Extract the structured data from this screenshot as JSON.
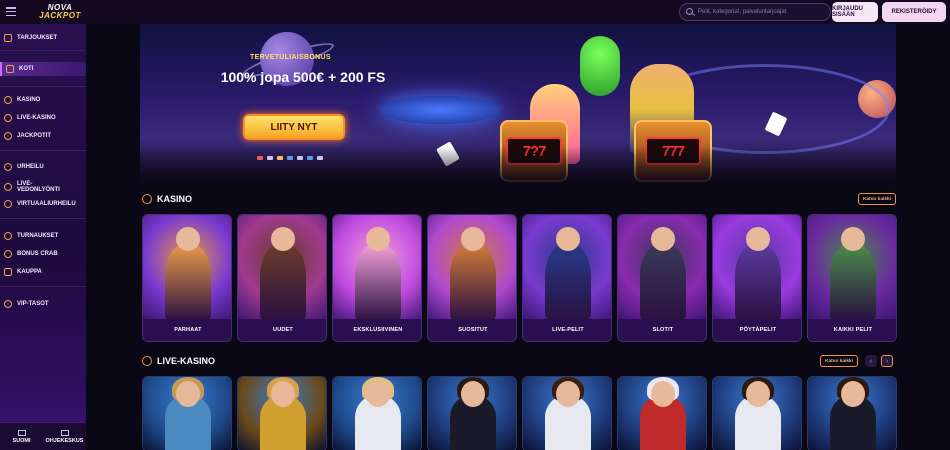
{
  "header": {
    "logo_line1": "NOVA",
    "logo_line2": "JACKPOT",
    "search_placeholder": "Pelit, kategoriat, palveluntarjoajat",
    "login_label": "KIRJAUDU SISÄÄN",
    "register_label": "REKISTERÖIDY"
  },
  "sidebar": {
    "items": [
      {
        "label": "TARJOUKSET",
        "icon": "gift-icon"
      },
      {
        "label": "KOTI",
        "icon": "home-icon",
        "active": true
      },
      {
        "label": "KASINO",
        "icon": "casino-chip-icon"
      },
      {
        "label": "LIVE-KASINO",
        "icon": "live-icon"
      },
      {
        "label": "JACKPOTIT",
        "icon": "jackpot-icon"
      },
      {
        "label": "URHEILU",
        "icon": "sports-icon"
      },
      {
        "label": "LIVE-VEDONLYÖNTI",
        "icon": "live-betting-icon"
      },
      {
        "label": "VIRTUAALIURHEILU",
        "icon": "virtual-sports-icon"
      },
      {
        "label": "TURNAUKSET",
        "icon": "tournament-icon"
      },
      {
        "label": "BONUS CRAB",
        "icon": "crab-icon"
      },
      {
        "label": "KAUPPA",
        "icon": "shop-icon"
      },
      {
        "label": "VIP-TASOT",
        "icon": "vip-icon"
      }
    ],
    "bottom": {
      "language_label": "SUOMI",
      "help_label": "OHJEKESKUS"
    }
  },
  "hero": {
    "subtitle": "TERVETULIAISBONUS",
    "title": "100% jopa 500€ + 200 FS",
    "cta_label": "LIITY NYT",
    "slot_left": "7?7",
    "slot_right": "777"
  },
  "casino": {
    "title": "KASINO",
    "see_all": "Katso kaikki",
    "cards": [
      {
        "label": "PARHAAT",
        "c1": "#7a3ad0",
        "c2": "#e89a4a"
      },
      {
        "label": "UUDET",
        "c1": "#a03a90",
        "c2": "#6a3a2a"
      },
      {
        "label": "EKSKLUSIIVINEN",
        "c1": "#c04ae0",
        "c2": "#f0a0d8"
      },
      {
        "label": "SUOSITUT",
        "c1": "#b04ad0",
        "c2": "#d07a3a"
      },
      {
        "label": "LIVE-PELIT",
        "c1": "#7a3ad0",
        "c2": "#2a3a8a"
      },
      {
        "label": "SLOTIT",
        "c1": "#8a2ab0",
        "c2": "#3a3a5a"
      },
      {
        "label": "PÖYTÄPELIT",
        "c1": "#9a3ae0",
        "c2": "#5a3aa0"
      },
      {
        "label": "KAIKKI PELIT",
        "c1": "#6a2aa0",
        "c2": "#4a8a4a"
      }
    ]
  },
  "live_casino": {
    "title": "LIVE-KASINO",
    "see_all": "Katso kaikki",
    "prev_icon": "‹",
    "next_icon": "›",
    "cards": [
      {
        "bg": "#1e4a8a",
        "hair": "#c89a5a",
        "outfit": "#4a8ac0"
      },
      {
        "bg": "#6a4a1a",
        "hair": "#d8a04a",
        "outfit": "#d0a030"
      },
      {
        "bg": "#1e4a8a",
        "hair": "#e0c080",
        "outfit": "#e8e8f0"
      },
      {
        "bg": "#1e3a7a",
        "hair": "#2a1a10",
        "outfit": "#1a1a2a"
      },
      {
        "bg": "#1e3a7a",
        "hair": "#3a2010",
        "outfit": "#e8e8f0"
      },
      {
        "bg": "#1e3a7a",
        "hair": "#e8e8f0",
        "outfit": "#c02a2a"
      },
      {
        "bg": "#1e3a7a",
        "hair": "#2a1a10",
        "outfit": "#e8e8f0"
      },
      {
        "bg": "#1e3a7a",
        "hair": "#2a1a10",
        "outfit": "#1a1a2a"
      }
    ]
  }
}
